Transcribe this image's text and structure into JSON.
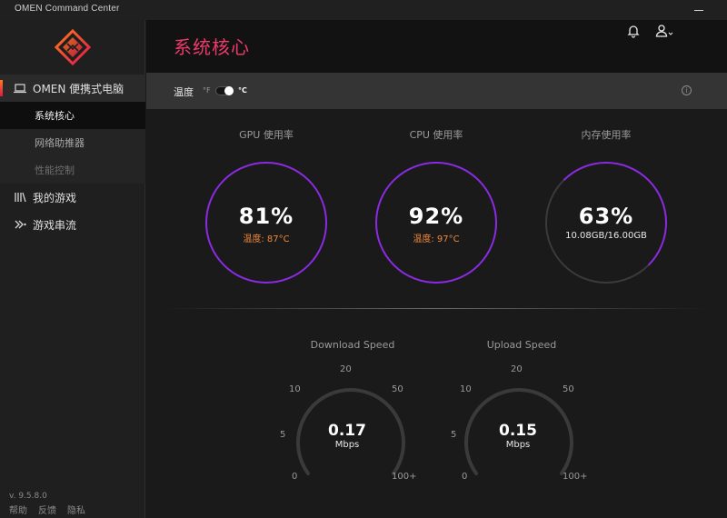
{
  "window": {
    "title": "OMEN Command Center"
  },
  "sidebar": {
    "device": "OMEN 便携式电脑",
    "sub_items": [
      {
        "label": "系统核心",
        "state": "active"
      },
      {
        "label": "网络助推器",
        "state": "normal"
      },
      {
        "label": "性能控制",
        "state": "disabled"
      }
    ],
    "items": [
      {
        "label": "我的游戏",
        "icon": "library-icon"
      },
      {
        "label": "游戏串流",
        "icon": "stream-icon"
      }
    ],
    "version": "v. 9.5.8.0",
    "footer": [
      "帮助",
      "反馈",
      "隐私"
    ]
  },
  "header": {
    "title": "系统核心"
  },
  "temperature": {
    "label": "温度",
    "unit_f": "°F",
    "unit_c": "°C",
    "selected": "°C"
  },
  "cards": [
    {
      "title": "GPU 使用率",
      "value": "81%",
      "sub": "温度: 87°C",
      "ring_color": "#8a2be2"
    },
    {
      "title": "CPU 使用率",
      "value": "92%",
      "sub": "温度: 97°C",
      "ring_color": "#8a2be2"
    },
    {
      "title": "内存使用率",
      "value": "63%",
      "sub": "10.08GB/16.00GB",
      "ring_color": "#8a2be2"
    }
  ],
  "speeds": [
    {
      "title": "Download Speed",
      "value": "0.17",
      "unit": "Mbps"
    },
    {
      "title": "Upload Speed",
      "value": "0.15",
      "unit": "Mbps"
    }
  ],
  "gauge_ticks": [
    "0",
    "5",
    "10",
    "20",
    "50",
    "100+"
  ],
  "colors": {
    "accent": "#ee3a6a",
    "ring": "#8a2be2",
    "temp_text": "#f0883a"
  }
}
